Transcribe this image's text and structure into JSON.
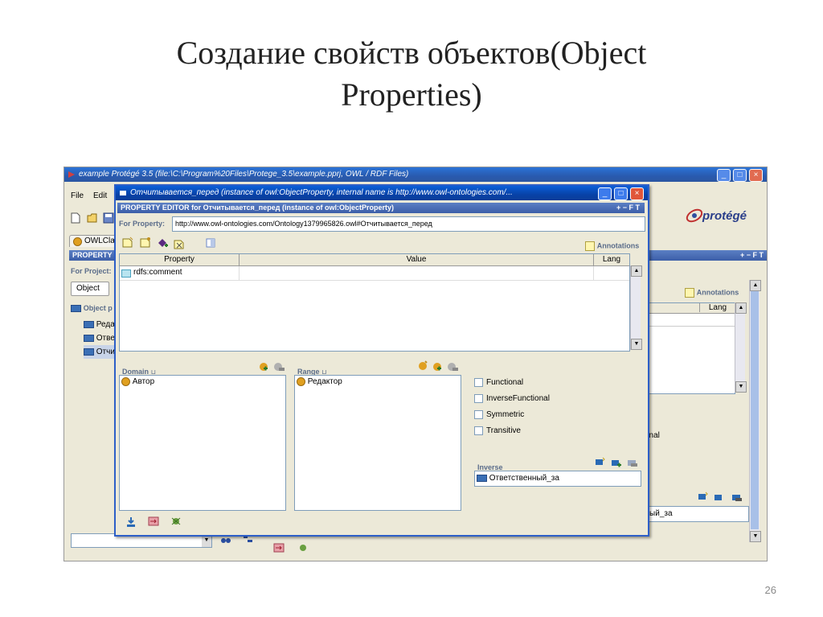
{
  "slide": {
    "title_line1": "Создание свойств объектов(Object",
    "title_line2": "Properties)",
    "page_number": "26"
  },
  "main_window": {
    "title": "example  Protégé 3.5     (file:\\C:\\Program%20Files\\Protege_3.5\\example.pprj, OWL / RDF Files)",
    "menu": [
      "File",
      "Edit"
    ],
    "brand": "protégé",
    "tab_label": "OWLCla",
    "header_left": "PROPERTY B",
    "for_project": "For Project:",
    "subtab": "Object",
    "tree_header": "Object p",
    "tree_items": [
      "Реда",
      "Отве",
      "Отчи"
    ],
    "annotations_label": "Annotations",
    "lang_header": "Lang",
    "functional_partial": "onal",
    "inverse_partial": "нный_за",
    "header_controls": "+ − F T"
  },
  "editor": {
    "title": "Отчитывается_перед   (instance of owl:ObjectProperty, internal name is http://www.owl-ontologies.com/...",
    "header": "PROPERTY EDITOR for Отчитывается_перед   (instance of owl:ObjectProperty)",
    "header_controls": "+ − F T",
    "for_property_label": "For Property:",
    "for_property_value": "http://www.owl-ontologies.com/Ontology1379965826.owl#Отчитывается_перед",
    "annotations_label": "Annotations",
    "columns": {
      "property": "Property",
      "value": "Value",
      "lang": "Lang"
    },
    "rows": [
      {
        "property": "rdfs:comment",
        "value": "",
        "lang": ""
      }
    ],
    "domain_label": "Domain",
    "domain_items": [
      "Автор"
    ],
    "range_label": "Range",
    "range_items": [
      "Редактор"
    ],
    "characteristics": [
      "Functional",
      "InverseFunctional",
      "Symmetric",
      "Transitive"
    ],
    "inverse_label": "Inverse",
    "inverse_value": "Ответственный_за"
  },
  "colors": {
    "titlebar": "#0842a8",
    "header_bar": "#3c5ea8",
    "window_bg": "#ece9d8",
    "pane_border": "#7f9db9"
  }
}
